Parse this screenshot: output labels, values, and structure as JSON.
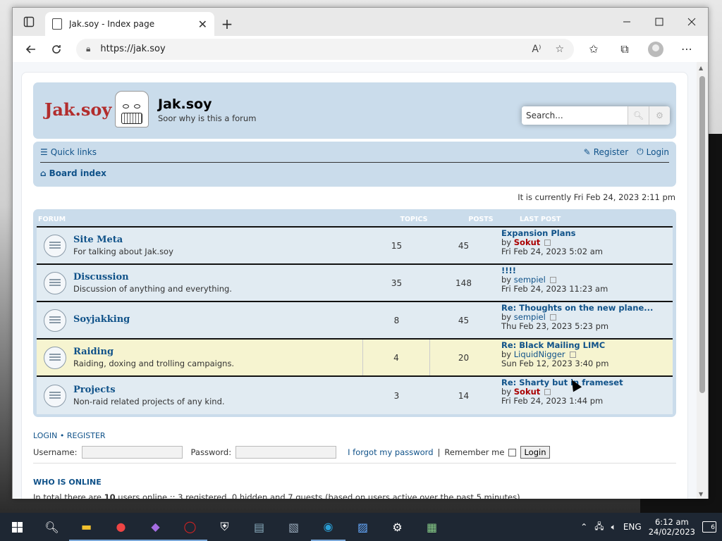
{
  "browser": {
    "tab_title": "Jak.soy - Index page",
    "url": "https://jak.soy",
    "new_tab": "+",
    "tab_close": "✕"
  },
  "header": {
    "logo_text": "Jak.soy",
    "site_title": "Jak.soy",
    "site_desc": "Soor why is this a forum",
    "search_placeholder": "Search..."
  },
  "nav": {
    "quick_links": "Quick links",
    "register": "Register",
    "login": "Login",
    "board_index": "Board index"
  },
  "current_time": "It is currently Fri Feb 24, 2023 2:11 pm",
  "forum_table": {
    "headers": [
      "FORUM",
      "TOPICS",
      "POSTS",
      "LAST POST"
    ],
    "rows": [
      {
        "name": "Site Meta",
        "desc": "For talking about Jak.soy",
        "topics": "15",
        "posts": "45",
        "last_title": "Expansion Plans",
        "by": "by",
        "last_user": "Sokut",
        "user_red": true,
        "last_time": "Fri Feb 24, 2023 5:02 am"
      },
      {
        "name": "Discussion",
        "desc": "Discussion of anything and everything.",
        "topics": "35",
        "posts": "148",
        "last_title": "!!!!",
        "by": "by",
        "last_user": "sempiel",
        "user_red": false,
        "last_time": "Fri Feb 24, 2023 11:23 am"
      },
      {
        "name": "Soyjakking",
        "desc": "",
        "topics": "8",
        "posts": "45",
        "last_title": "Re: Thoughts on the new plane...",
        "by": "by",
        "last_user": "sempiel",
        "user_red": false,
        "last_time": "Thu Feb 23, 2023 5:23 pm"
      },
      {
        "name": "Raiding",
        "desc": "Raiding, doxing and trolling campaigns.",
        "topics": "4",
        "posts": "20",
        "last_title": "Re: Black Mailing LIMC",
        "by": "by",
        "last_user": "LiquidNigger",
        "user_red": false,
        "last_time": "Sun Feb 12, 2023 3:40 pm"
      },
      {
        "name": "Projects",
        "desc": "Non-raid related projects of any kind.",
        "topics": "3",
        "posts": "14",
        "last_title": "Re: Sharty but in frameset",
        "by": "by",
        "last_user": "Sokut",
        "user_red": true,
        "last_time": "Fri Feb 24, 2023 1:44 pm"
      }
    ]
  },
  "login": {
    "header_login": "LOGIN",
    "header_sep": "•",
    "header_register": "REGISTER",
    "username_label": "Username:",
    "password_label": "Password:",
    "forgot": "I forgot my password",
    "sep": "|",
    "remember": "Remember me",
    "button": "Login"
  },
  "who_online": {
    "header": "WHO IS ONLINE",
    "text_pre": "In total there are ",
    "count": "10",
    "text_post": " users online :: 3 registered, 0 hidden and 7 guests (based on users active over the past 5 minutes)"
  },
  "taskbar": {
    "language": "ENG",
    "time": "6:12 am",
    "date": "24/02/2023",
    "notifications": "6"
  }
}
